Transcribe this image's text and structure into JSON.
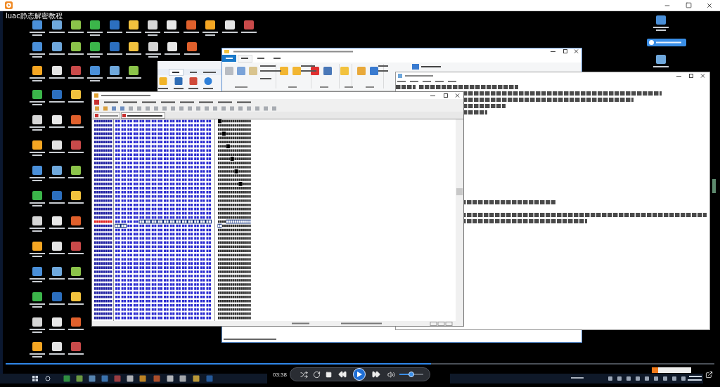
{
  "video": {
    "title": "luac静态解密教程"
  },
  "controls": {
    "time": "03:38",
    "playing": false,
    "progress": {
      "level": 0.6
    },
    "volume": {
      "level": 0.5
    }
  }
}
